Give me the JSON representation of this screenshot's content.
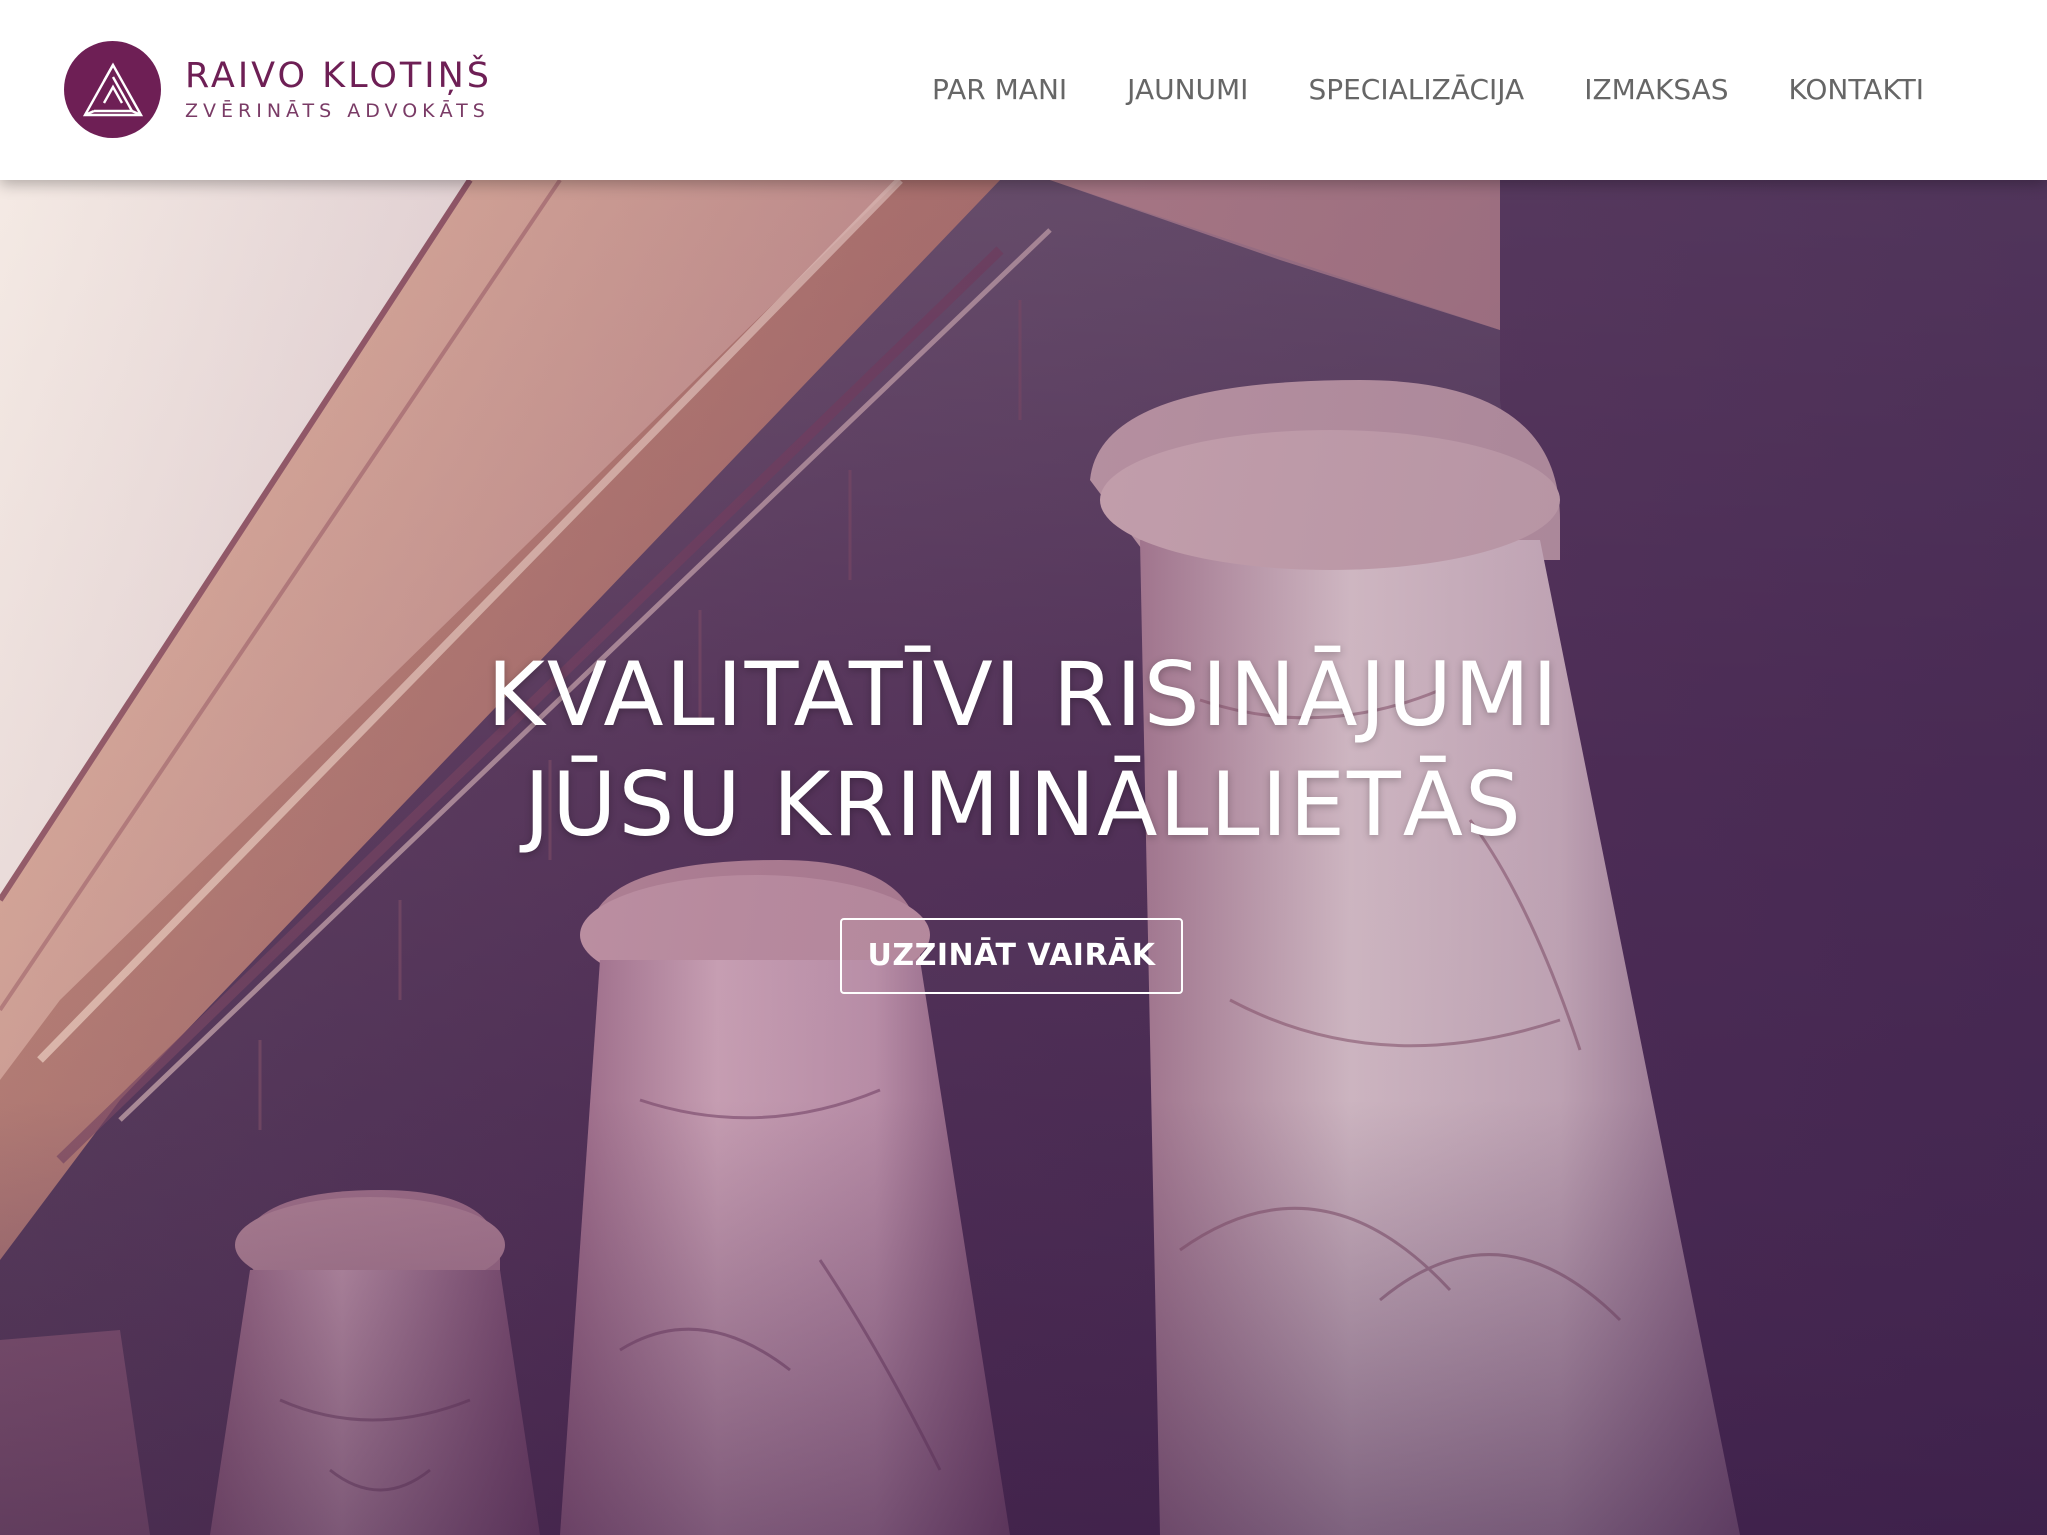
{
  "brand": {
    "name": "RAIVO KLOTIŅŠ",
    "subtitle": "ZVĒRINĀTS ADVOKĀTS",
    "logo_icon": "impossible-triangle-icon",
    "logo_color": "#6e1f55"
  },
  "nav": {
    "items": [
      {
        "label": "PAR MANI"
      },
      {
        "label": "JAUNUMI"
      },
      {
        "label": "SPECIALIZĀCIJA"
      },
      {
        "label": "IZMAKSAS"
      },
      {
        "label": "KONTAKTI"
      }
    ]
  },
  "hero": {
    "title_line1": "KVALITATĪVI RISINĀJUMI",
    "title_line2": "JŪSU KRIMINĀLLIETĀS",
    "cta_label": "UZZINĀT VAIRĀK",
    "background_image": "courthouse-columns-photo"
  },
  "colors": {
    "accent": "#6e1f55",
    "nav_text": "#666666",
    "hero_text": "#ffffff"
  }
}
